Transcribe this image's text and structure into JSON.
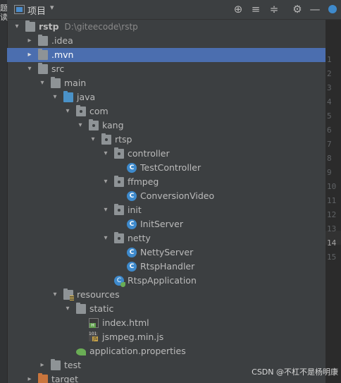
{
  "left_strip": {
    "chars": [
      "题",
      "读"
    ]
  },
  "header": {
    "title": "项目",
    "toolbar": [
      "target-icon",
      "expand-all-icon",
      "collapse-all-icon",
      "settings-icon",
      "minimize-icon"
    ]
  },
  "tree": [
    {
      "label": "rstp",
      "path": "D:\\giteecode\\rstp",
      "icon": "module-folder",
      "depth": 0,
      "arrow": "▾",
      "bold": true
    },
    {
      "label": ".idea",
      "icon": "folder",
      "depth": 1,
      "arrow": "▸"
    },
    {
      "label": ".mvn",
      "icon": "folder",
      "depth": 1,
      "arrow": "▸",
      "selected": true
    },
    {
      "label": "src",
      "icon": "folder",
      "depth": 1,
      "arrow": "▾"
    },
    {
      "label": "main",
      "icon": "folder",
      "depth": 2,
      "arrow": "▾"
    },
    {
      "label": "java",
      "icon": "source-folder",
      "depth": 3,
      "arrow": "▾"
    },
    {
      "label": "com",
      "icon": "package",
      "depth": 4,
      "arrow": "▾"
    },
    {
      "label": "kang",
      "icon": "package",
      "depth": 5,
      "arrow": "▾"
    },
    {
      "label": "rtsp",
      "icon": "package",
      "depth": 6,
      "arrow": "▾"
    },
    {
      "label": "controller",
      "icon": "package",
      "depth": 7,
      "arrow": "▾"
    },
    {
      "label": "TestController",
      "icon": "class",
      "depth": 8
    },
    {
      "label": "ffmpeg",
      "icon": "package",
      "depth": 7,
      "arrow": "▾"
    },
    {
      "label": "ConversionVideo",
      "icon": "class",
      "depth": 8
    },
    {
      "label": "init",
      "icon": "package",
      "depth": 7,
      "arrow": "▾"
    },
    {
      "label": "InitServer",
      "icon": "class",
      "depth": 8
    },
    {
      "label": "netty",
      "icon": "package",
      "depth": 7,
      "arrow": "▾"
    },
    {
      "label": "NettyServer",
      "icon": "class",
      "depth": 8
    },
    {
      "label": "RtspHandler",
      "icon": "class",
      "depth": 8
    },
    {
      "label": "RtspApplication",
      "icon": "spring-class",
      "depth": 7
    },
    {
      "label": "resources",
      "icon": "resources-folder",
      "depth": 3,
      "arrow": "▾"
    },
    {
      "label": "static",
      "icon": "folder",
      "depth": 4,
      "arrow": "▾"
    },
    {
      "label": "index.html",
      "icon": "html-file",
      "depth": 5
    },
    {
      "label": "jsmpeg.min.js",
      "icon": "js-file",
      "depth": 5
    },
    {
      "label": "application.properties",
      "icon": "properties-file",
      "depth": 4
    },
    {
      "label": "test",
      "icon": "folder",
      "depth": 2,
      "arrow": "▸"
    },
    {
      "label": "target",
      "icon": "excluded-folder",
      "depth": 1,
      "arrow": "▸"
    }
  ],
  "editor": {
    "line_numbers": [
      "1",
      "2",
      "3",
      "4",
      "5",
      "6",
      "7",
      "8",
      "9",
      "10",
      "11",
      "12",
      "13",
      "14",
      "15"
    ],
    "current_line": "14"
  },
  "watermark": "CSDN @不杠不是杨明康",
  "colors": {
    "background": "#3c3f41",
    "selection": "#4b6eaf",
    "text": "#bbbbbb",
    "editor_bg": "#2b2b2b"
  }
}
